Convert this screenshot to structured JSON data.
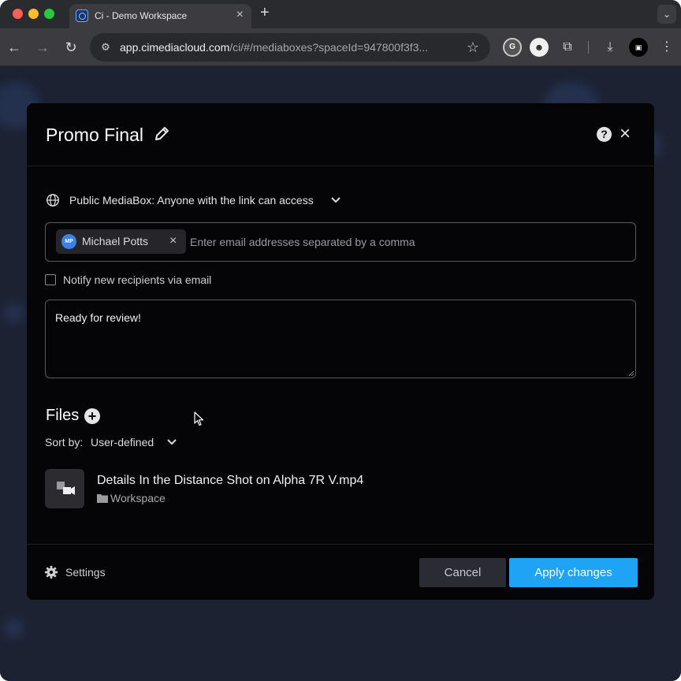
{
  "browser": {
    "tab": {
      "title": "Ci - Demo Workspace"
    },
    "address_bar": {
      "host": "app.cimediacloud.com",
      "path": "/ci/#/mediaboxes?spaceId=947800f3f3..."
    },
    "profile_initials": "",
    "extension_label": ""
  },
  "modal": {
    "title": "Promo Final",
    "access": {
      "label": "Public MediaBox: Anyone with the link can access"
    },
    "recipients": {
      "chips": [
        {
          "initials": "MP",
          "name": "Michael Potts"
        }
      ],
      "placeholder": "Enter email addresses separated by a comma",
      "value": ""
    },
    "notify": {
      "label": "Notify new recipients via email",
      "checked": false
    },
    "message": {
      "value": "Ready for review!"
    },
    "files": {
      "heading": "Files",
      "sort_label": "Sort by:",
      "sort_value": "User-defined",
      "items": [
        {
          "name": "Details In the Distance Shot on Alpha 7R V.mp4",
          "location": "Workspace"
        }
      ]
    },
    "footer": {
      "settings_label": "Settings",
      "cancel_label": "Cancel",
      "apply_label": "Apply changes"
    }
  },
  "colors": {
    "accent": "#1ea3f5",
    "modal_background": "#050507",
    "avatar": "#3b82e8"
  }
}
